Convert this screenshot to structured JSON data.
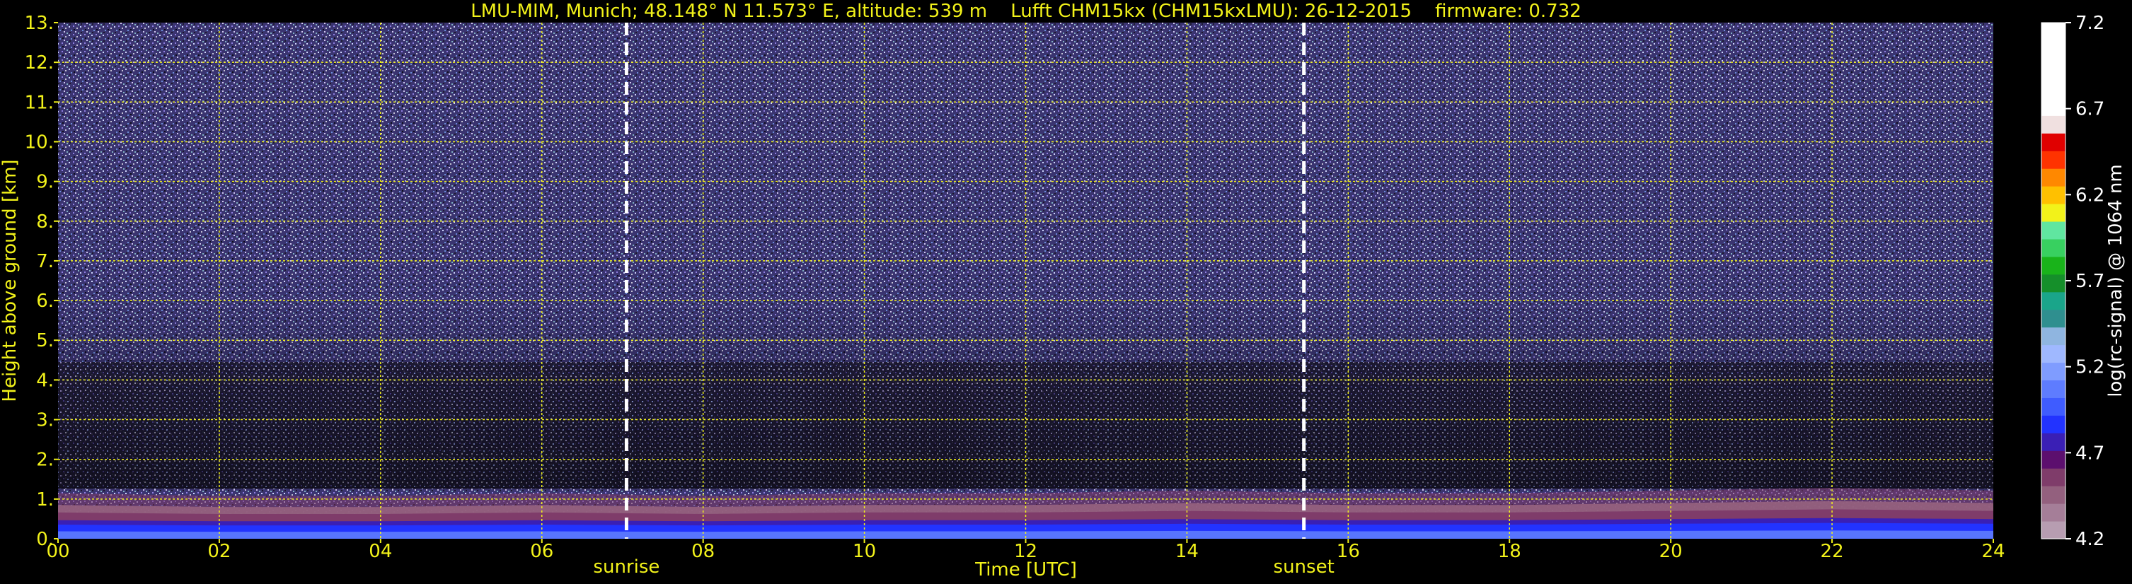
{
  "title": "LMU-MIM, Munich; 48.148° N 11.573° E, altitude: 539 m    Lufft CHM15kx (CHM15kxLMU): 26-12-2015    firmware: 0.732",
  "chart_data": {
    "type": "heatmap",
    "xlabel": "Time [UTC]",
    "ylabel": "Height above ground [km]",
    "xlim": [
      0,
      24
    ],
    "ylim": [
      0,
      13
    ],
    "x_ticks": [
      "00",
      "02",
      "04",
      "06",
      "08",
      "10",
      "12",
      "14",
      "16",
      "18",
      "20",
      "22",
      "24"
    ],
    "x_tick_values": [
      0,
      2,
      4,
      6,
      8,
      10,
      12,
      14,
      16,
      18,
      20,
      22,
      24
    ],
    "y_ticks": [
      "0.",
      "1.",
      "2.",
      "3.",
      "4.",
      "5.",
      "6.",
      "7.",
      "8.",
      "9.",
      "10.",
      "11.",
      "12.",
      "13."
    ],
    "y_tick_values": [
      0,
      1,
      2,
      3,
      4,
      5,
      6,
      7,
      8,
      9,
      10,
      11,
      12,
      13
    ],
    "grid": true,
    "grid_color": "#f2f21a",
    "annotations": [
      {
        "label": "sunrise",
        "time": 7.05
      },
      {
        "label": "sunset",
        "time": 15.45
      }
    ],
    "colorbar": {
      "label": "log(rc-signal) @ 1064 nm",
      "range": [
        4.2,
        7.2
      ],
      "ticks": [
        "4.2",
        "4.7",
        "5.2",
        "5.7",
        "6.2",
        "6.7",
        "7.2"
      ],
      "tick_values": [
        4.2,
        4.7,
        5.2,
        5.7,
        6.2,
        6.7,
        7.2
      ],
      "colors": [
        "#b79db1",
        "#a57e98",
        "#93607e",
        "#7f3c6a",
        "#5c0f6e",
        "#3a1fb5",
        "#2233ff",
        "#3f5cff",
        "#5e7cff",
        "#7f9cff",
        "#9fb8ff",
        "#8fb5e0",
        "#2f8f8f",
        "#1aa58a",
        "#158f2a",
        "#19b31a",
        "#38d060",
        "#60e6a0",
        "#f2f21a",
        "#ffc000",
        "#ff8800",
        "#ff3300",
        "#e00000",
        "#f0e0e0",
        "#ffffff"
      ]
    },
    "boundary_layer_top_km": [
      0.85,
      0.8,
      0.8,
      0.85,
      0.8,
      0.85,
      0.85,
      0.9,
      0.85,
      0.85,
      0.9,
      0.95,
      0.9
    ]
  }
}
